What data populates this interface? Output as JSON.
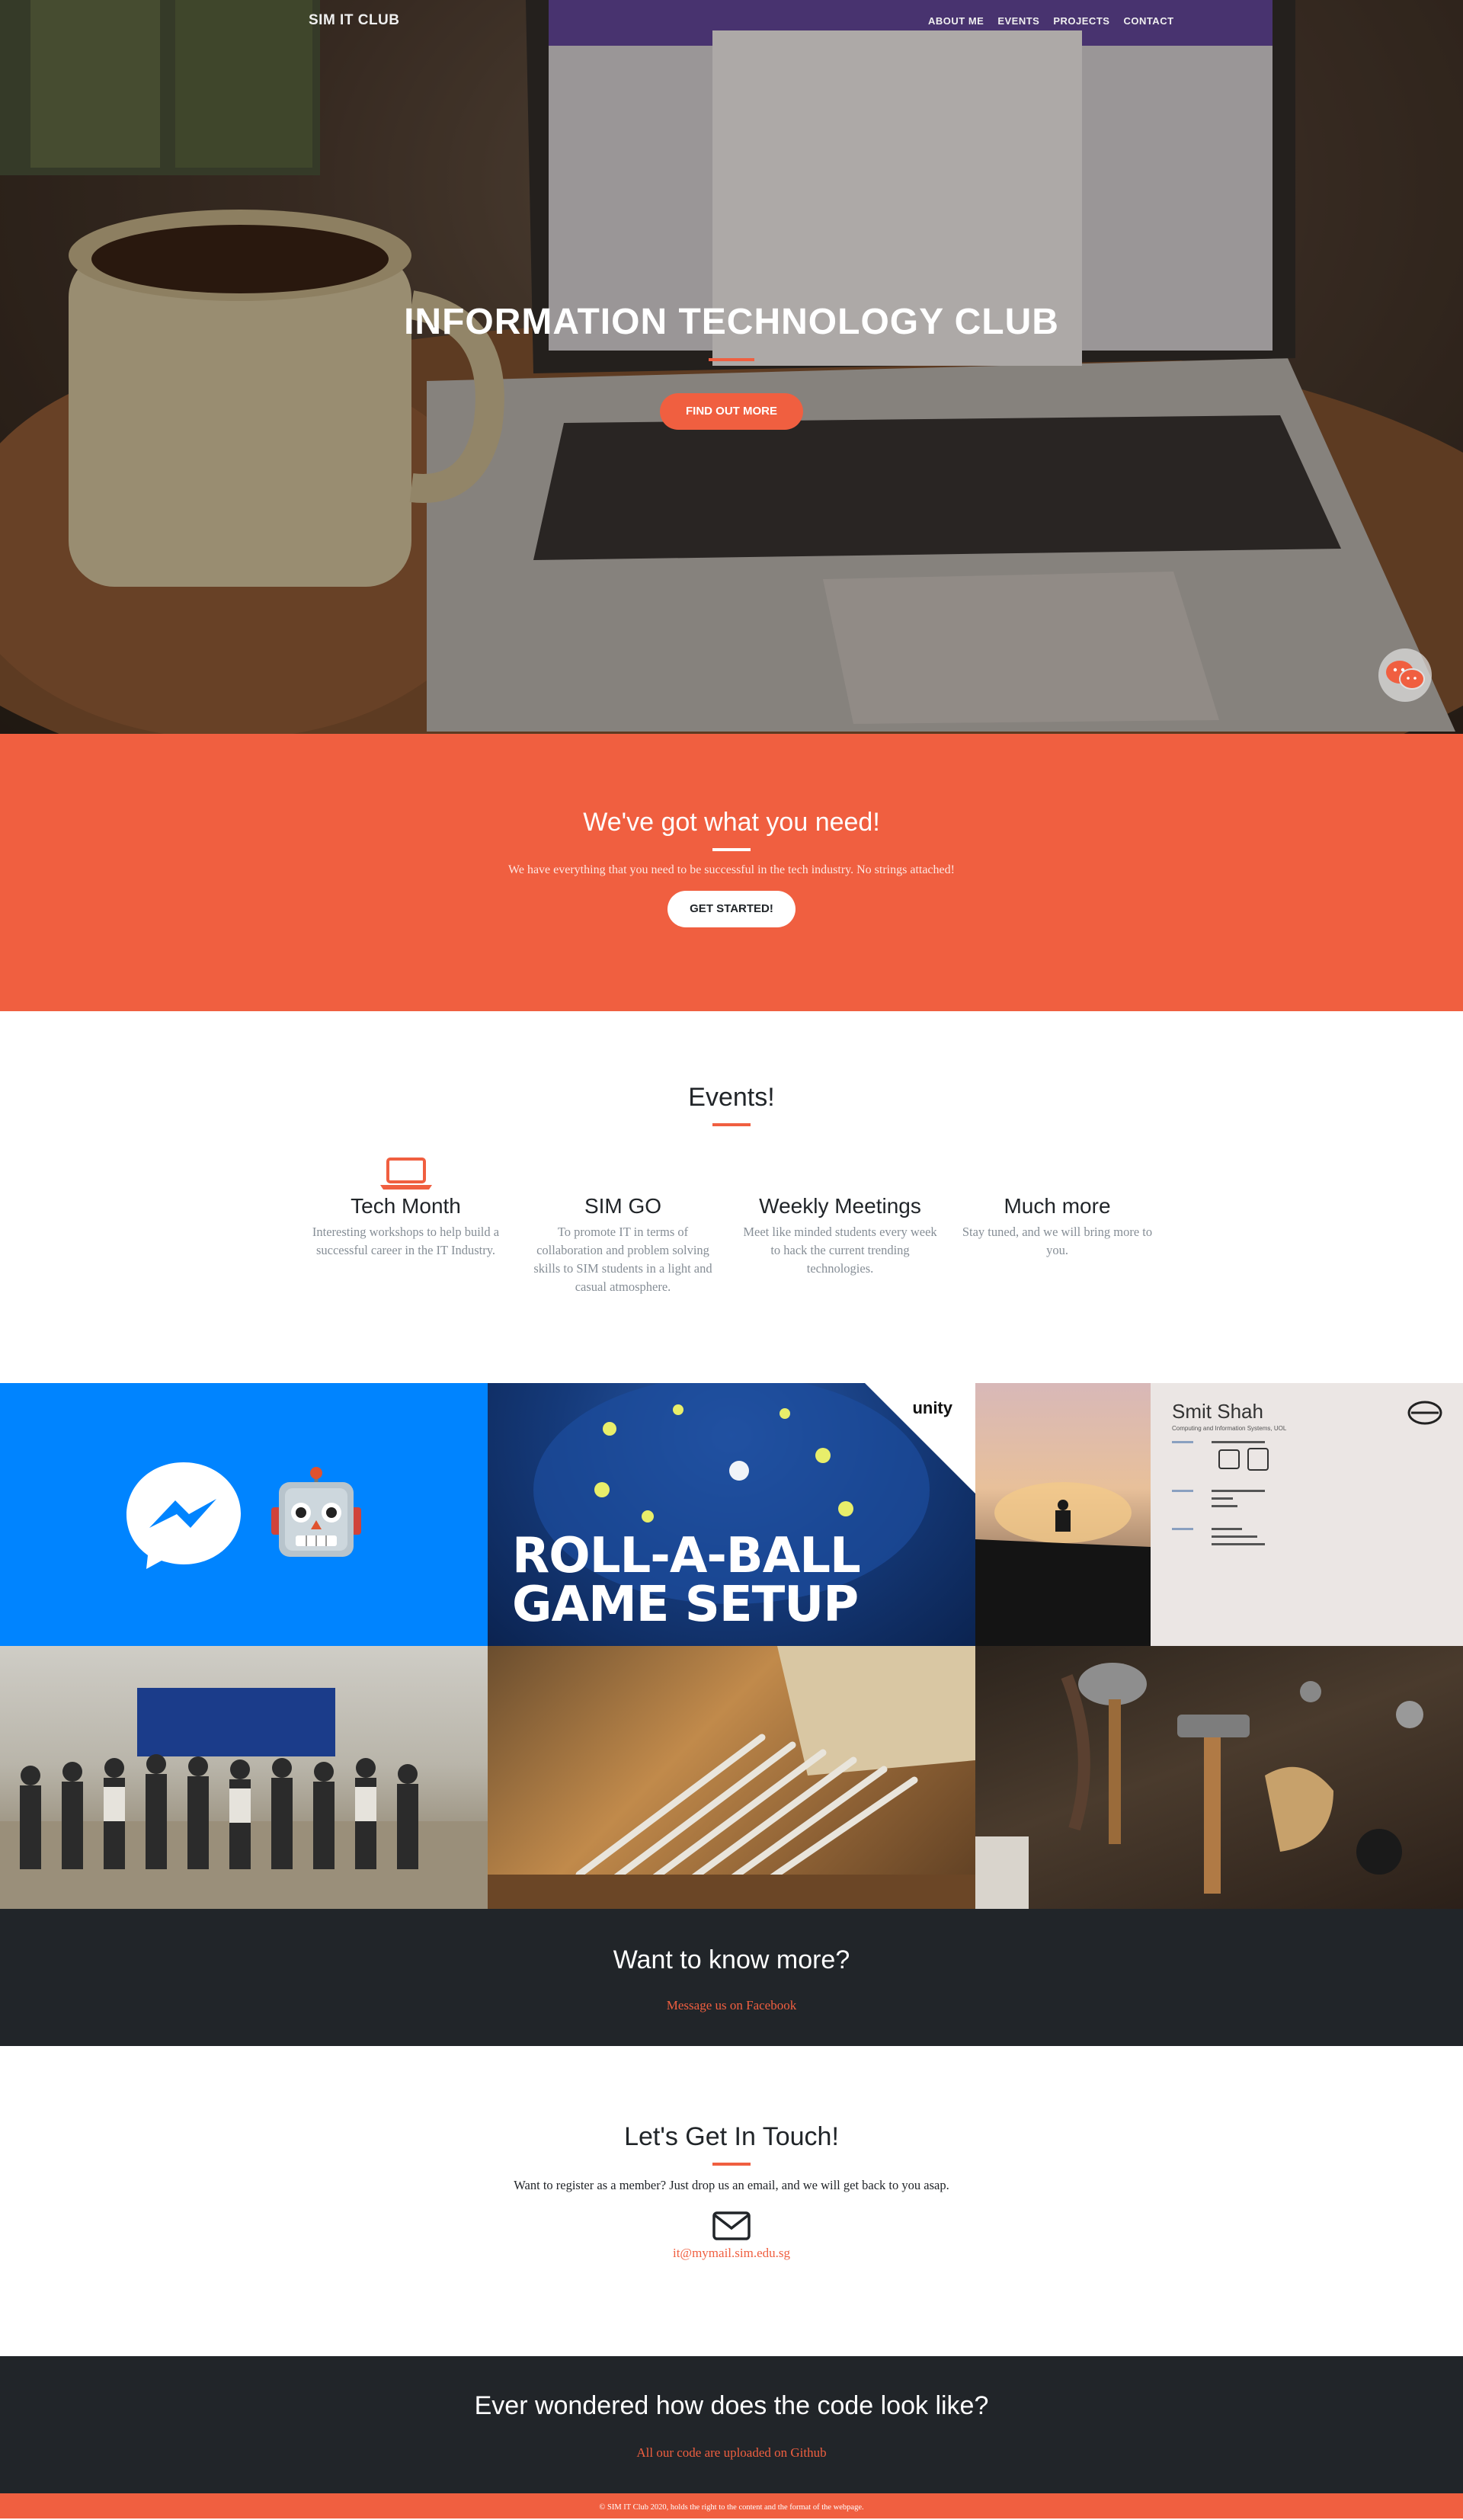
{
  "nav": {
    "brand": "SIM IT CLUB",
    "links": [
      "ABOUT ME",
      "EVENTS",
      "PROJECTS",
      "CONTACT"
    ]
  },
  "hero": {
    "title": "INFORMATION TECHNOLOGY CLUB",
    "button": "FIND OUT MORE"
  },
  "about": {
    "heading": "We've got what you need!",
    "text": "We have everything that you need to be successful in the tech industry. No strings attached!",
    "button": "GET STARTED!"
  },
  "events": {
    "heading": "Events!",
    "items": [
      {
        "title": "Tech Month",
        "text": "Interesting workshops to help build a successful career in the IT Industry.",
        "icon": "laptop-icon"
      },
      {
        "title": "SIM GO",
        "text": "To promote IT in terms of collaboration and problem solving skills to SIM students in a light and casual atmosphere.",
        "icon": ""
      },
      {
        "title": "Weekly Meetings",
        "text": "Meet like minded students every week to hack the current trending technologies.",
        "icon": ""
      },
      {
        "title": "Much more",
        "text": "Stay tuned, and we will bring more to you.",
        "icon": ""
      }
    ]
  },
  "portfolio": {
    "unity_title_line1": "ROLL-A-BALL",
    "unity_title_line2": "GAME SETUP",
    "unity_logo": "unity",
    "smit_name": "Smit Shah",
    "smit_sub": "Computing and Information Systems, UOL"
  },
  "cta": {
    "heading": "Want to know more?",
    "link": "Message us on Facebook"
  },
  "contact": {
    "heading": "Let's Get In Touch!",
    "text": "Want to register as a member? Just drop us an email, and we will get back to you asap.",
    "email": "it@mymail.sim.edu.sg"
  },
  "code": {
    "heading": "Ever wondered how does the code look like?",
    "link": "All our code are uploaded on Github"
  },
  "footer": {
    "text": "© SIM IT Club 2020, holds the right to the content and the format of the webpage."
  },
  "colors": {
    "primary": "#f05f40",
    "dark": "#212529",
    "messenger": "#0084ff"
  }
}
